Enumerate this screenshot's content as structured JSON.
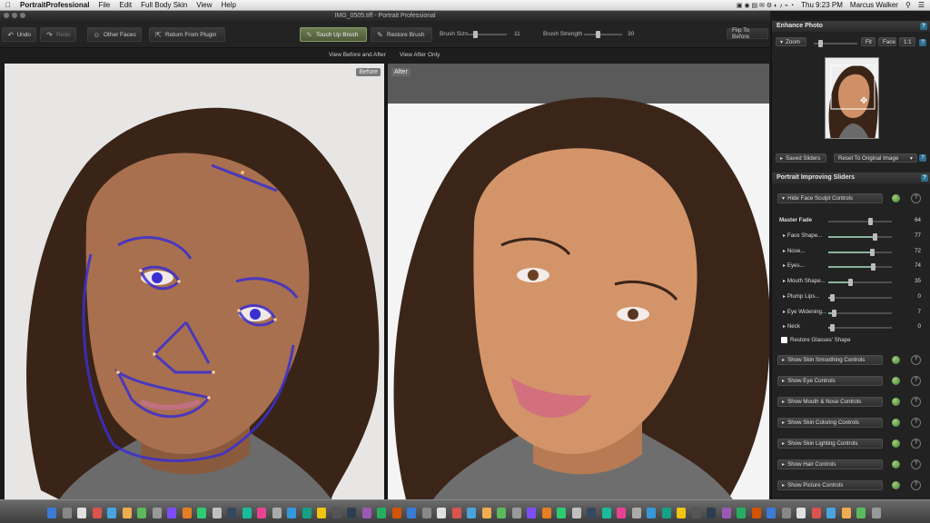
{
  "menubar": {
    "apple_icon": "apple-icon",
    "app_name": "PortraitProfessional",
    "menus": [
      "File",
      "Edit",
      "Full Body Skin",
      "View",
      "Help"
    ],
    "tray_time": "Thu 9:23 PM",
    "user": "Marcus Walker"
  },
  "window": {
    "title": "IMG_0505.tiff - Portrait Professional"
  },
  "toolbar": {
    "undo": "Undo",
    "redo": "Redo",
    "other_faces": "Other Faces",
    "return_plugin": "Return From Plugin",
    "touch_up": "Touch Up Brush",
    "restore": "Restore Brush",
    "brush_size_label": "Brush Size",
    "brush_size_value": "11",
    "brush_size_fraction": 0.2,
    "brush_strength_label": "Brush Strength",
    "brush_strength_value": "30",
    "brush_strength_fraction": 0.3,
    "flip": "Flip To Before"
  },
  "view_modes": {
    "before_after": "View Before and After",
    "after_only": "View After Only"
  },
  "panes": {
    "before_tag": "Before",
    "after_tag": "After"
  },
  "panel": {
    "title": "Enhance Photo",
    "help": "?",
    "zoom_label": "Zoom",
    "zoom_fraction": 0.1,
    "fit": "Fit",
    "face": "Face",
    "one_to_one": "1:1",
    "saved_sliders": "Saved Sliders",
    "reset": "Reset To Original Image",
    "improving_title": "Portrait Improving Sliders",
    "hide_sculpt": "Hide Face Sculpt Controls",
    "master_fade_label": "Master Fade",
    "master_fade_value": "64",
    "sliders": [
      {
        "label": "Face Shape...",
        "value": "77"
      },
      {
        "label": "Nose...",
        "value": "72"
      },
      {
        "label": "Eyes...",
        "value": "74"
      },
      {
        "label": "Mouth Shape...",
        "value": "35"
      },
      {
        "label": "Plump Lips...",
        "value": "0"
      },
      {
        "label": "Eye Widening...",
        "value": "7"
      },
      {
        "label": "Neck",
        "value": "0"
      }
    ],
    "restore_glasses": "Restore Glasses' Shape",
    "controls": [
      "Show Skin Smoothing Controls",
      "Show Eye Controls",
      "Show Mouth & Nose Controls",
      "Show Skin Coloring Controls",
      "Show Skin Lighting Controls",
      "Show Hair Controls",
      "Show Picture Controls"
    ]
  },
  "colors": {
    "accent_green": "#6e7f52",
    "help_blue": "#2b6f8f",
    "face_outline": "#3a2fd0"
  }
}
